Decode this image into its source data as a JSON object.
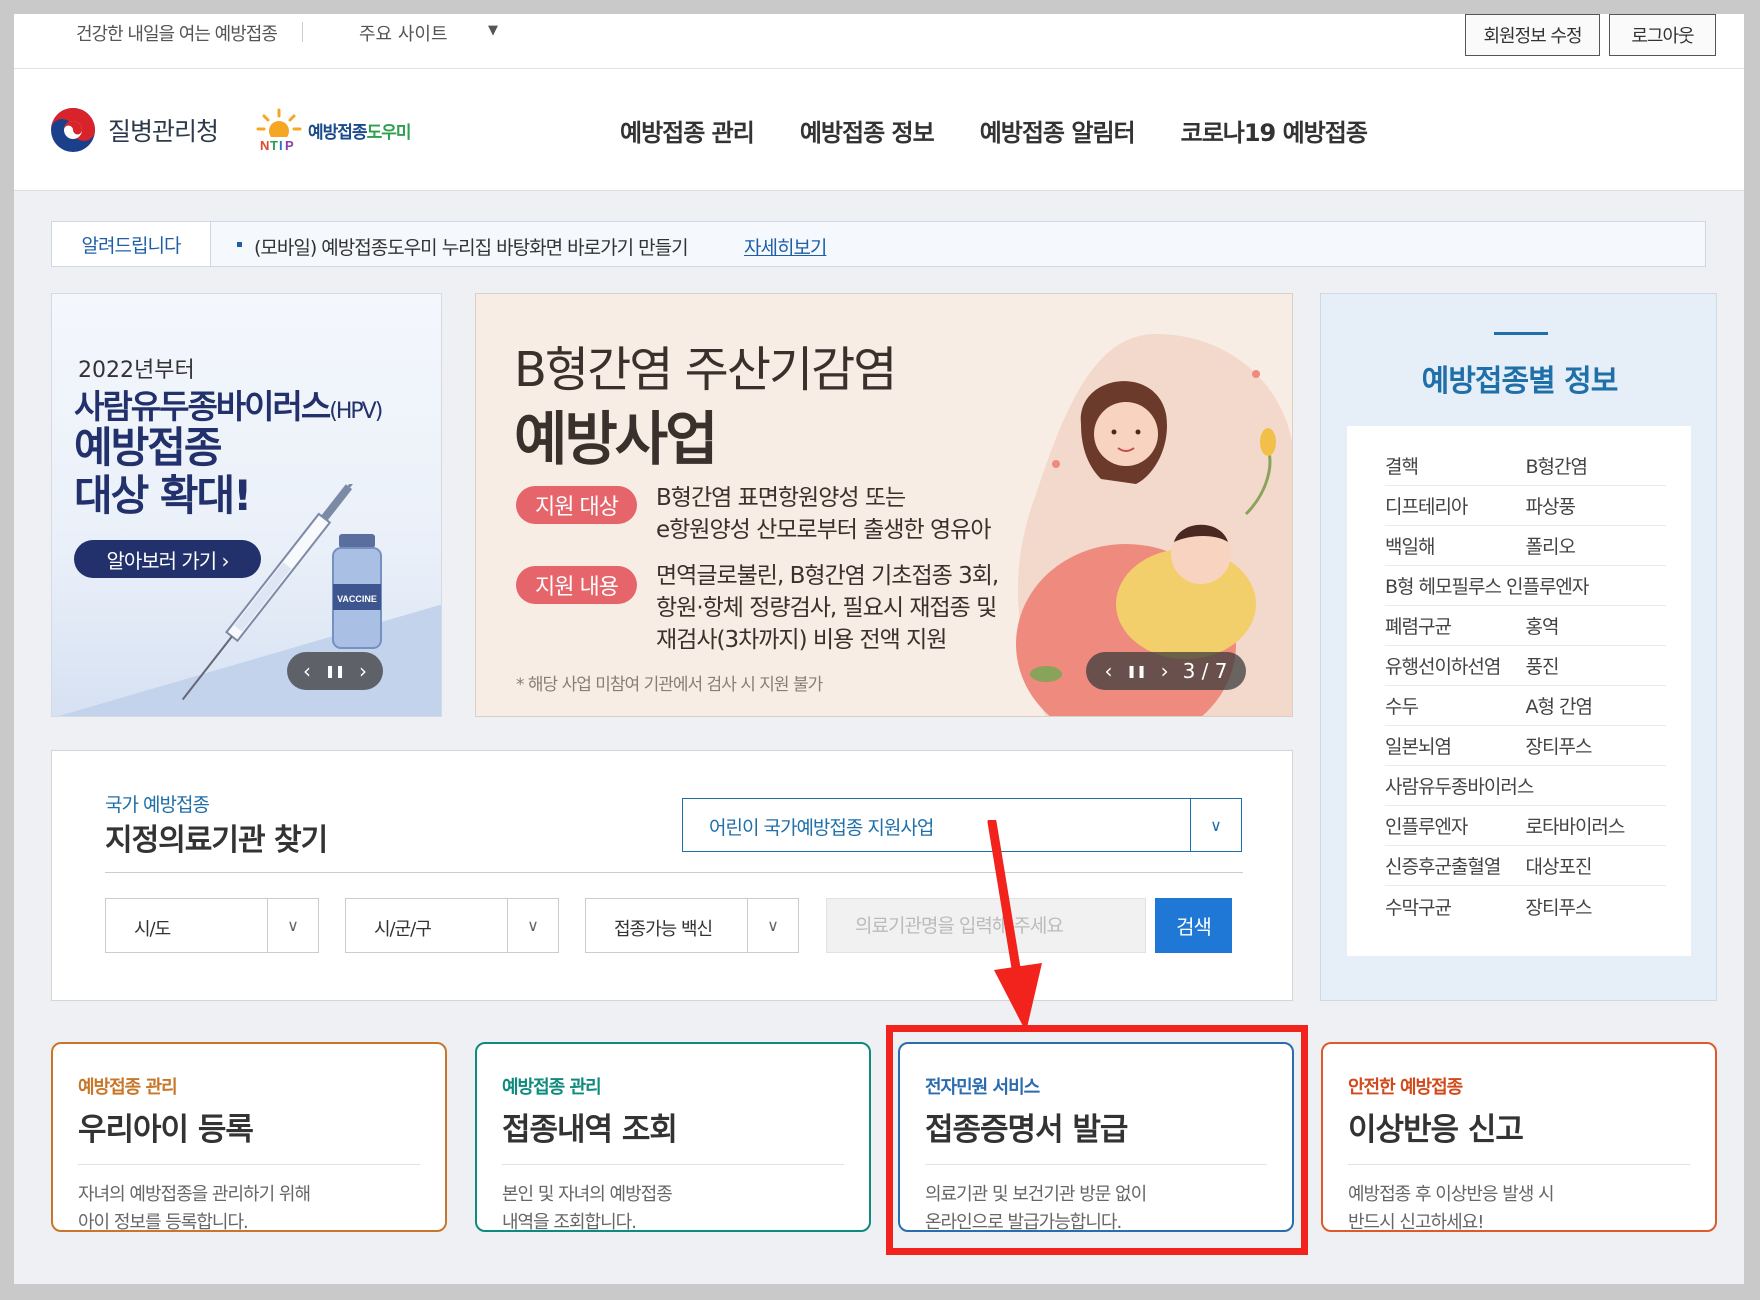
{
  "utility": {
    "slogan": "건강한 내일을 여는 예방접종",
    "sites_label": "주요 사이트",
    "edit_profile": "회원정보 수정",
    "logout": "로그아웃"
  },
  "header": {
    "agency_name": "질병관리청",
    "service_name_prefix": "예방접종",
    "service_name_highlight": "도우미",
    "nav": [
      "예방접종 관리",
      "예방접종 정보",
      "예방접종 알림터",
      "코로나19 예방접종"
    ]
  },
  "notice": {
    "tag": "알려드립니다",
    "text": "(모바일) 예방접종도우미 누리집 바탕화면 바로가기 만들기",
    "more": "자세히보기"
  },
  "banner_hpv": {
    "year": "2022년부터",
    "title1": "사람유두종바이러스",
    "title1_suffix": "(HPV)",
    "title2a": "예방접종",
    "title2b": "대상 확대!",
    "button": "알아보러 가기  ›",
    "vial_label": "VACCINE",
    "slider_prev": "‹",
    "slider_pause": "❚❚",
    "slider_next": "›"
  },
  "banner_hbv": {
    "title1": "B형간염 주산기감염",
    "title2": "예방사업",
    "target_label": "지원 대상",
    "target_line1": "B형간염 표면항원양성 또는",
    "target_line2": "e항원양성 산모로부터 출생한 영유아",
    "content_label": "지원 내용",
    "content_line1": "면역글로불린, B형간염 기초접종 3회,",
    "content_line2": "항원·항체 정량검사, 필요시 재접종 및",
    "content_line3": "재검사(3차까지) 비용 전액 지원",
    "footnote": "* 해당 사업 미참여 기관에서 검사 시 지원 불가",
    "slider_prev": "‹",
    "slider_pause": "❚❚",
    "slider_next": "›",
    "page_indicator": "3 / 7"
  },
  "info_panel": {
    "title": "예방접종별 정보",
    "rows": [
      [
        "결핵",
        "B형간염"
      ],
      [
        "디프테리아",
        "파상풍"
      ],
      [
        "백일해",
        "폴리오"
      ],
      [
        "B형 헤모필루스 인플루엔자",
        ""
      ],
      [
        "폐렴구균",
        "홍역"
      ],
      [
        "유행선이하선염",
        "풍진"
      ],
      [
        "수두",
        "A형 간염"
      ],
      [
        "일본뇌염",
        "장티푸스"
      ],
      [
        "사람유두종바이러스",
        ""
      ],
      [
        "인플루엔자",
        "로타바이러스"
      ],
      [
        "신증후군출혈열",
        "대상포진"
      ],
      [
        "수막구균",
        "장티푸스"
      ]
    ]
  },
  "search": {
    "subtitle": "국가 예방접종",
    "title": "지정의료기관 찾기",
    "program_value": "어린이 국가예방접종 지원사업",
    "sido": "시/도",
    "sigungu": "시/군/구",
    "vaccine": "접종가능 백신",
    "keyword_placeholder": "의료기관명을 입력해 주세요",
    "search_button": "검색"
  },
  "cards": [
    {
      "category": "예방접종 관리",
      "title": "우리아이 등록",
      "desc1": "자녀의 예방접종을 관리하기 위해",
      "desc2": "아이 정보를 등록합니다."
    },
    {
      "category": "예방접종 관리",
      "title": "접종내역 조회",
      "desc1": "본인 및 자녀의 예방접종",
      "desc2": "내역을 조회합니다."
    },
    {
      "category": "전자민원 서비스",
      "title": "접종증명서 발급",
      "desc1": "의료기관 및 보건기관 방문 없이",
      "desc2": "온라인으로 발급가능합니다."
    },
    {
      "category": "안전한 예방접종",
      "title": "이상반응 신고",
      "desc1": "예방접종 후 이상반응 발생 시",
      "desc2": "반드시 신고하세요!"
    }
  ],
  "colors": {
    "primary_blue": "#1f6fa8",
    "navy": "#22306b",
    "pink": "#e6656b",
    "highlight_red": "#f2231c"
  }
}
